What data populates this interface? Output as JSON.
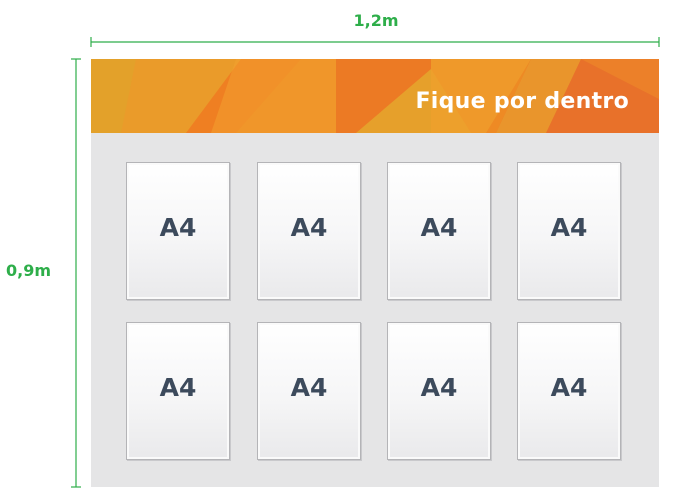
{
  "dimensions": {
    "width_label": "1,2m",
    "height_label": "0,9m",
    "line_color": "#2eae4a"
  },
  "banner": {
    "title": "Fique por dentro",
    "colors": [
      "#e3a12a",
      "#ee7f22",
      "#f29b2c",
      "#e8712a"
    ]
  },
  "pockets": [
    {
      "label": "A4"
    },
    {
      "label": "A4"
    },
    {
      "label": "A4"
    },
    {
      "label": "A4"
    },
    {
      "label": "A4"
    },
    {
      "label": "A4"
    },
    {
      "label": "A4"
    },
    {
      "label": "A4"
    }
  ]
}
